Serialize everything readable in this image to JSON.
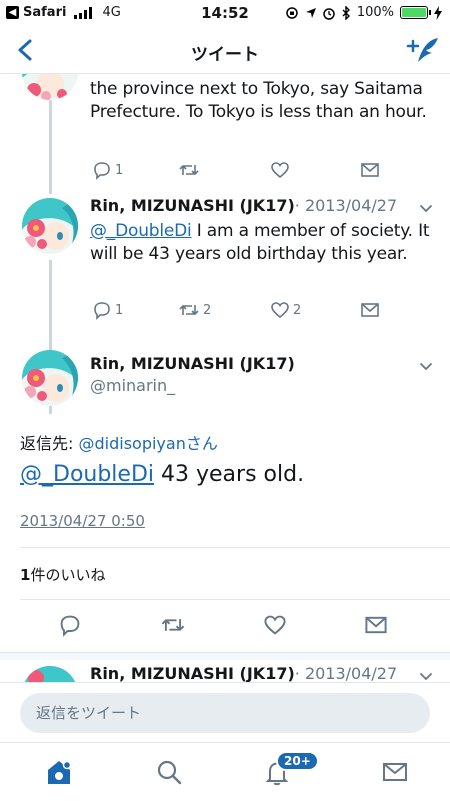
{
  "status_bar": {
    "back_app": "Safari",
    "network": "4G",
    "time": "14:52",
    "battery": "100%"
  },
  "nav": {
    "title": "ツイート"
  },
  "tweets": [
    {
      "text": "the province next to Tokyo, say Saitama Prefecture. To Tokyo is less than an hour.",
      "reply_count": "1",
      "retweet_count": "",
      "like_count": ""
    },
    {
      "author": "Rin, MIZUNASHI (JK17)",
      "date": "· 2013/04/27",
      "mention": "@_DoubleDi",
      "text": " I am a member of society. It will be 43 years old birthday this year.",
      "reply_count": "1",
      "retweet_count": "2",
      "like_count": "2"
    }
  ],
  "main_tweet": {
    "author": "Rin, MIZUNASHI (JK17)",
    "handle": "@minarin_",
    "reply_to_label": "返信先: ",
    "reply_to_user": "@didisopiyanさん",
    "mention": "@_DoubleDi",
    "text": " 43 years old.",
    "timestamp": "2013/04/27 0:50",
    "likes_count": "1",
    "likes_label": "件のいいね"
  },
  "next_tweet": {
    "author": "Rin, MIZUNASHI (JK17)",
    "date": "· 2013/04/27"
  },
  "reply_bar": {
    "placeholder": "返信をツイート"
  },
  "tab_bar": {
    "notifications_badge": "20+"
  },
  "colors": {
    "accent": "#1b6ab1",
    "muted": "#657786",
    "divider": "#e1e8ed"
  }
}
